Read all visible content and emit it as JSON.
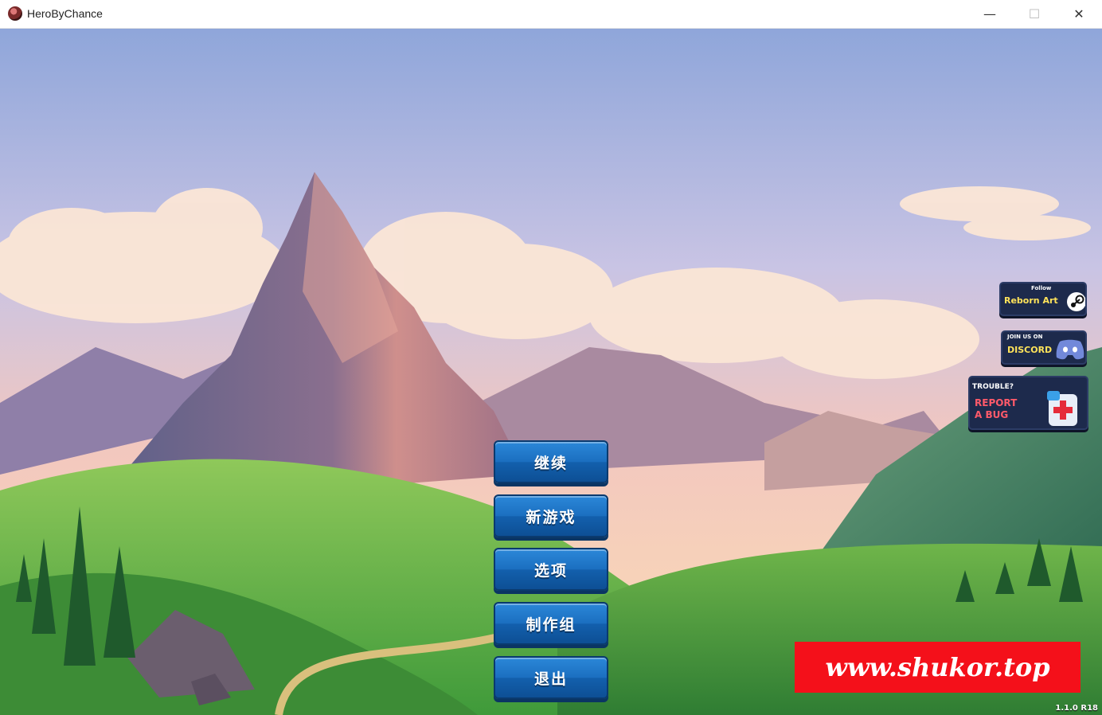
{
  "window": {
    "title": "HeroByChance",
    "minimize_glyph": "—",
    "maximize_glyph": "☐",
    "close_glyph": "✕"
  },
  "menu": {
    "items": [
      {
        "label": "继续"
      },
      {
        "label": "新游戏"
      },
      {
        "label": "选项"
      },
      {
        "label": "制作组"
      },
      {
        "label": "退出"
      }
    ]
  },
  "social": {
    "steam": {
      "small": "Follow",
      "big": "Reborn Art",
      "icon": "steam-icon"
    },
    "discord": {
      "small": "JOIN US ON",
      "big": "DISCORD",
      "icon": "discord-icon"
    },
    "bug": {
      "small": "TROUBLE?",
      "big1": "REPORT",
      "big2": "A BUG",
      "icon": "first-aid-kit-icon"
    }
  },
  "version": "1.1.0 R18",
  "watermark": "www.shukor.top",
  "colors": {
    "button": "#1b6fc0",
    "card": "#1d2a4c",
    "accent_yellow": "#ffe35a",
    "accent_red": "#ff5a6a",
    "watermark_bg": "#f4101a"
  }
}
